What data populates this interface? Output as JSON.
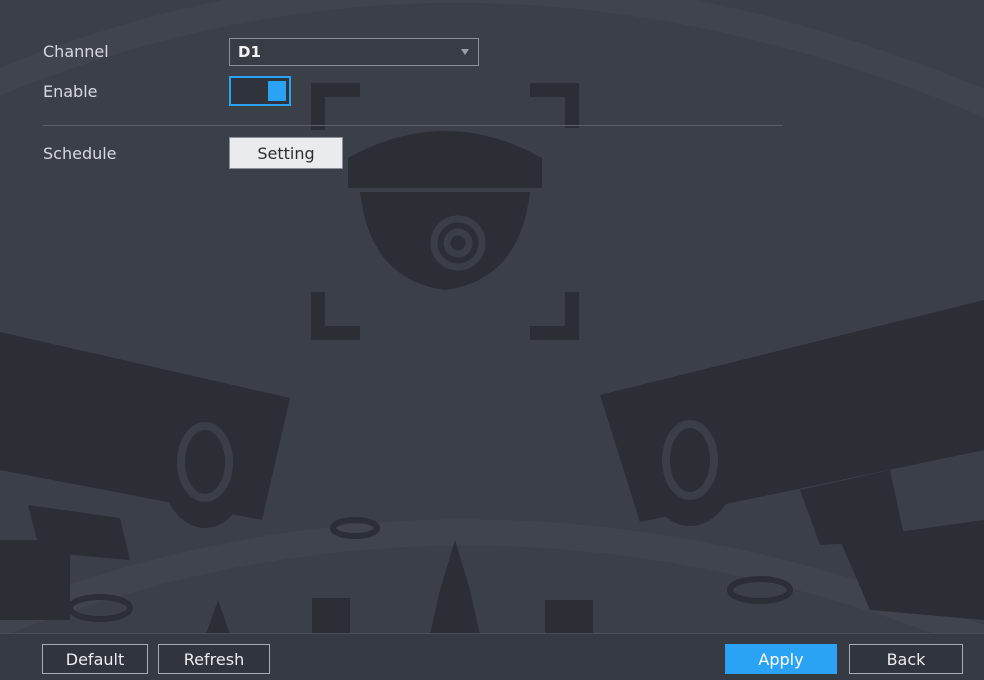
{
  "form": {
    "channel_label": "Channel",
    "channel_value": "D1",
    "enable_label": "Enable",
    "enable_state": "on",
    "schedule_label": "Schedule",
    "schedule_button": "Setting"
  },
  "footer": {
    "default_label": "Default",
    "refresh_label": "Refresh",
    "apply_label": "Apply",
    "back_label": "Back"
  },
  "colors": {
    "accent": "#2aa3f4",
    "background": "#3b3f48",
    "watermark": "#2f323a"
  },
  "background_art": {
    "watermark_icons": [
      "dome-camera-icon",
      "bullet-camera-icon",
      "building-icon",
      "cloud-icon"
    ]
  }
}
